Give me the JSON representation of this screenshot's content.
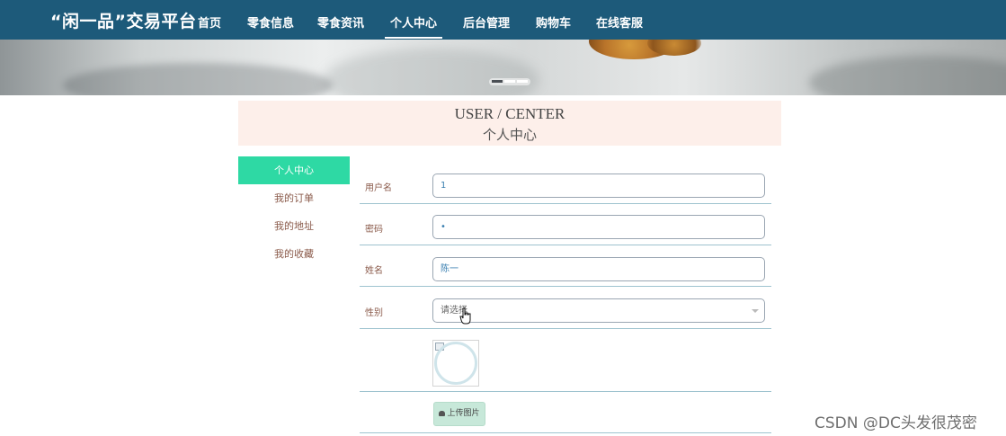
{
  "header": {
    "brand": "“闲一品”交易平台",
    "nav": [
      "首页",
      "零食信息",
      "零食资讯",
      "个人中心",
      "后台管理",
      "购物车",
      "在线客服"
    ],
    "active_nav": "个人中心",
    "bg_color": "#1d5a7a"
  },
  "banner": {
    "slide_count": 3,
    "active_slide": 1
  },
  "title": {
    "en": "USER / CENTER",
    "cn": "个人中心"
  },
  "sidebar": {
    "items": [
      "个人中心",
      "我的订单",
      "我的地址",
      "我的收藏"
    ],
    "active": "个人中心",
    "active_color": "#2ed9a4"
  },
  "form": {
    "username": {
      "label": "用户名",
      "value": "1"
    },
    "password": {
      "label": "密码",
      "value": "•"
    },
    "name": {
      "label": "姓名",
      "value": "陈一"
    },
    "gender": {
      "label": "性别",
      "value": "请选择"
    },
    "upload_label": "上传图片"
  },
  "watermark": "CSDN @DC头发很茂密"
}
